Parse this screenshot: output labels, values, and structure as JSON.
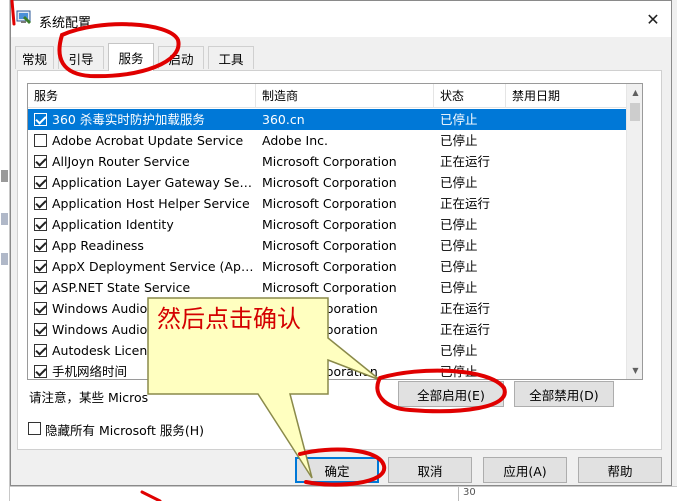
{
  "window": {
    "title": "系统配置",
    "close_glyph": "✕"
  },
  "tabs": [
    {
      "label": "常规"
    },
    {
      "label": "引导"
    },
    {
      "label": "服务",
      "active": true
    },
    {
      "label": "启动"
    },
    {
      "label": "工具"
    }
  ],
  "list": {
    "columns": {
      "service": "服务",
      "manufacturer": "制造商",
      "status": "状态",
      "disabled_date": "禁用日期"
    },
    "rows": [
      {
        "name": "360 杀毒实时防护加载服务",
        "manufacturer": "360.cn",
        "status": "已停止",
        "checked": true,
        "selected": true
      },
      {
        "name": "Adobe Acrobat Update Service",
        "manufacturer": "Adobe Inc.",
        "status": "已停止",
        "checked": false
      },
      {
        "name": "AllJoyn Router Service",
        "manufacturer": "Microsoft Corporation",
        "status": "正在运行",
        "checked": true
      },
      {
        "name": "Application Layer Gateway Service",
        "manufacturer": "Microsoft Corporation",
        "status": "已停止",
        "checked": true
      },
      {
        "name": "Application Host Helper Service",
        "manufacturer": "Microsoft Corporation",
        "status": "正在运行",
        "checked": true
      },
      {
        "name": "Application Identity",
        "manufacturer": "Microsoft Corporation",
        "status": "已停止",
        "checked": true
      },
      {
        "name": "App Readiness",
        "manufacturer": "Microsoft Corporation",
        "status": "已停止",
        "checked": true
      },
      {
        "name": "AppX Deployment Service (AppX...",
        "manufacturer": "Microsoft Corporation",
        "status": "已停止",
        "checked": true
      },
      {
        "name": "ASP.NET State Service",
        "manufacturer": "Microsoft Corporation",
        "status": "已停止",
        "checked": true
      },
      {
        "name": "Windows Audio",
        "manufacturer": "Corporation",
        "status": "正在运行",
        "checked": true
      },
      {
        "name": "Windows Audio",
        "manufacturer": "Corporation",
        "status": "正在运行",
        "checked": true
      },
      {
        "name": "Autodesk Licens",
        "manufacturer": "",
        "status": "已停止",
        "checked": true
      },
      {
        "name": "手机网络时间",
        "manufacturer": "Corporation",
        "status": "已停止",
        "checked": true
      }
    ]
  },
  "note": "请注意，某些 Micros",
  "buttons": {
    "enable_all": "全部启用(E)",
    "disable_all": "全部禁用(D)",
    "ok": "确定",
    "cancel": "取消",
    "apply": "应用(A)",
    "help": "帮助"
  },
  "hide_ms": {
    "label": "隐藏所有 Microsoft 服务(H)",
    "checked": false
  },
  "callout": {
    "text": "然后点击确认"
  },
  "background": {
    "bottom_fragment": "30"
  },
  "colors": {
    "selection": "#0078d7",
    "annotation_red": "#e00000",
    "callout_fill": "#ffffc0"
  }
}
